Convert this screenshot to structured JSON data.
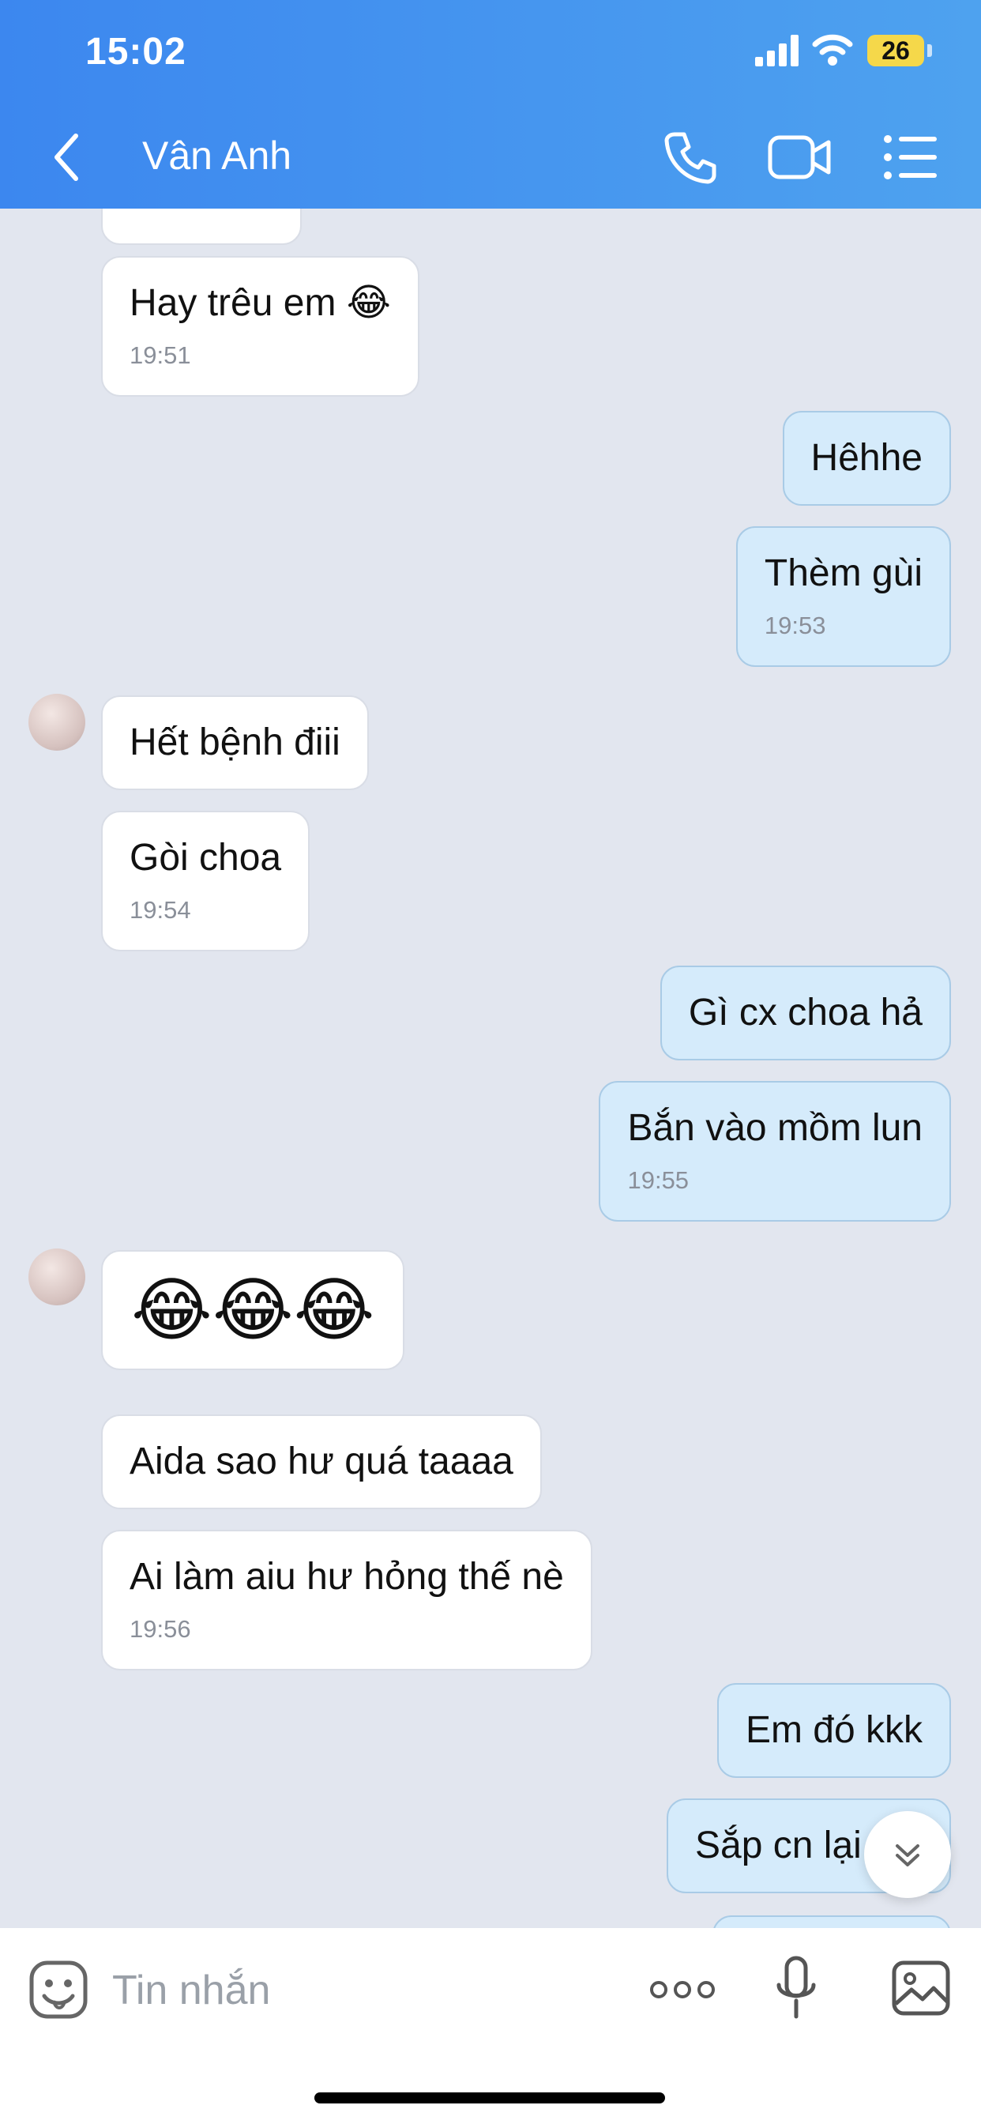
{
  "status_bar": {
    "time": "15:02",
    "battery": "26"
  },
  "header": {
    "contact_name": "Vân Anh",
    "icons": [
      "chevron-left-icon",
      "phone-icon",
      "video-camera-icon",
      "list-menu-icon"
    ]
  },
  "messages": [
    {
      "id": 0,
      "side": "in",
      "text": "Hay trêu em 😂",
      "time": "19:51"
    },
    {
      "id": 1,
      "side": "out",
      "text": "Hêhhe",
      "time": ""
    },
    {
      "id": 2,
      "side": "out",
      "text": "Thèm gùi",
      "time": "19:53"
    },
    {
      "id": 3,
      "side": "in",
      "text": "Hết bệnh điii",
      "time": ""
    },
    {
      "id": 4,
      "side": "in",
      "text": "Gòi choa",
      "time": "19:54"
    },
    {
      "id": 5,
      "side": "out",
      "text": "Gì cx choa hả",
      "time": ""
    },
    {
      "id": 6,
      "side": "out",
      "text": "Bắn vào mồm lun",
      "time": "19:55"
    },
    {
      "id": 7,
      "side": "in",
      "text": "😂😂😂",
      "time": ""
    },
    {
      "id": 8,
      "side": "in",
      "text": "Aida sao hư quá taaaa",
      "time": ""
    },
    {
      "id": 9,
      "side": "in",
      "text": "Ai làm aiu hư hỏng thế nè",
      "time": "19:56"
    },
    {
      "id": 10,
      "side": "out",
      "text": "Em đó kkk",
      "time": ""
    },
    {
      "id": 11,
      "side": "out",
      "text": "Sắp cn lại",
      "time": ""
    }
  ],
  "input": {
    "placeholder": "Tin nhắn"
  },
  "colors": {
    "header_start": "#3c87ef",
    "header_end": "#4ea2ef",
    "outgoing_bubble": "#d5ebfb",
    "incoming_bubble": "#ffffff",
    "chat_background": "#e2e6ef"
  }
}
